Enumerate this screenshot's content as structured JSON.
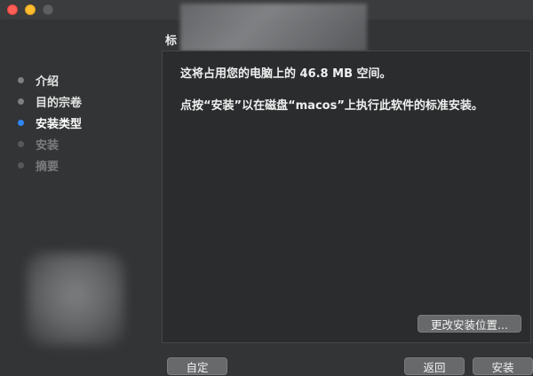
{
  "window": {
    "title_visible": "标"
  },
  "section": {
    "title": "标准安装"
  },
  "sidebar": {
    "steps": [
      {
        "label": "介绍",
        "state": "done"
      },
      {
        "label": "目的宗卷",
        "state": "done"
      },
      {
        "label": "安装类型",
        "state": "active"
      },
      {
        "label": "安装",
        "state": "pending"
      },
      {
        "label": "摘要",
        "state": "pending"
      }
    ]
  },
  "content": {
    "line1": "这将占用您的电脑上的 46.8 MB 空间。",
    "line2": "点按“安装”以在磁盘“macos”上执行此软件的标准安装。",
    "change_location_label": "更改安装位置..."
  },
  "footer": {
    "customize_label": "自定",
    "back_label": "返回",
    "install_label": "安装"
  },
  "colors": {
    "active_step": "#2f86f6",
    "close": "#fe5f57",
    "minimize": "#febc2e"
  }
}
